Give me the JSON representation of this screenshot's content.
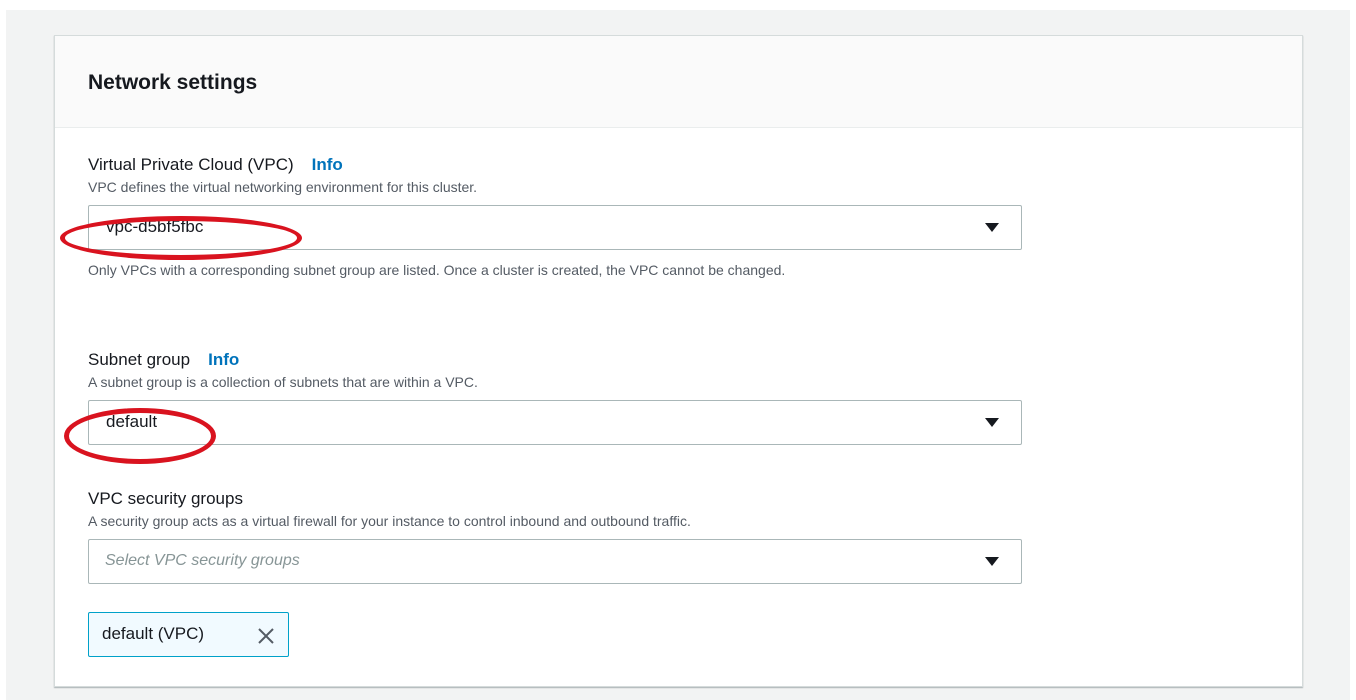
{
  "panel": {
    "title": "Network settings"
  },
  "vpc": {
    "label": "Virtual Private Cloud (VPC)",
    "info": "Info",
    "description": "VPC defines the virtual networking environment for this cluster.",
    "value": "vpc-d5bf5fbc",
    "hint": "Only VPCs with a corresponding subnet group are listed. Once a cluster is created, the VPC cannot be changed."
  },
  "subnet": {
    "label": "Subnet group",
    "info": "Info",
    "description": "A subnet group is a collection of subnets that are within a VPC.",
    "value": "default"
  },
  "security": {
    "label": "VPC security groups",
    "description": "A security group acts as a virtual firewall for your instance to control inbound and outbound traffic.",
    "placeholder": "Select VPC security groups",
    "tokens": [
      {
        "label": "default (VPC)"
      }
    ]
  },
  "icons": {
    "dropdown": "caret-down-icon",
    "remove": "close-icon"
  },
  "colors": {
    "link": "#0073bb",
    "annotation": "#d9131f",
    "token_border": "#00a1c9",
    "token_bg": "#f1faff"
  }
}
